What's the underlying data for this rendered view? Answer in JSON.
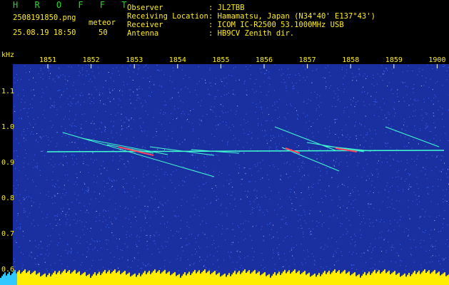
{
  "app_title": "H R O F F T",
  "file": "2508191850.png",
  "meteor_label": "meteor",
  "datetime": "25.08.19 18:50",
  "meteor_count": "50",
  "info": [
    {
      "label": "Observer",
      "value": ": JL2TBB"
    },
    {
      "label": "Receiving Location",
      "value": ": Hamamatsu, Japan (N34°40' E137°43')"
    },
    {
      "label": "Receiver",
      "value": ": ICOM IC-R2500 53.1000MHz USB"
    },
    {
      "label": "Antenna",
      "value": ": HB9CV Zenith dir."
    }
  ],
  "axis": {
    "y_unit": "kHz",
    "x_ticks": [
      "1851",
      "1852",
      "1853",
      "1854",
      "1855",
      "1856",
      "1857",
      "1858",
      "1859",
      "1900"
    ],
    "y_ticks": [
      "1.1",
      "1.0",
      "0.9",
      "0.8",
      "0.7",
      "0.6"
    ]
  },
  "colors": {
    "background": "#1a2fa0",
    "noise": "#3f6cff",
    "carrier": "#40ffd0",
    "meteor": "#ff4060",
    "level": "#ffee00",
    "text": "#ffee22"
  }
}
